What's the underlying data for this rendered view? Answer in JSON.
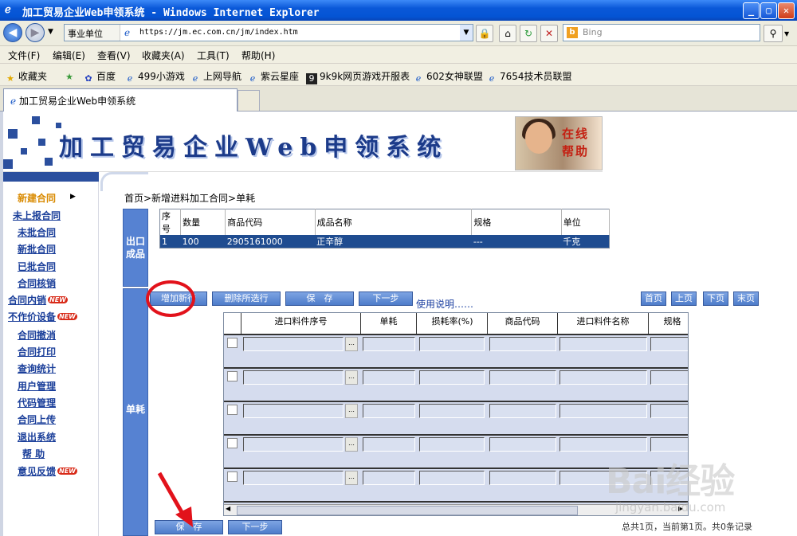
{
  "window": {
    "title": "加工贸易企业Web申领系统 - Windows Internet Explorer",
    "buttons": {
      "minimize": "_",
      "maximize": "▢",
      "close": "✕"
    }
  },
  "addressbar": {
    "segment": "事业单位",
    "url": "https://jm.ec.com.cn/jm/index.htm",
    "search_placeholder": "Bing"
  },
  "menu": [
    "文件(F)",
    "编辑(E)",
    "查看(V)",
    "收藏夹(A)",
    "工具(T)",
    "帮助(H)"
  ],
  "favorites": {
    "label": "收藏夹",
    "items": [
      "百度",
      "499小游戏",
      "上网导航",
      "紫云星座",
      "9k9k网页游戏开服表",
      "602女神联盟",
      "7654技术员联盟"
    ]
  },
  "tab": {
    "title": "加工贸易企业Web申领系统"
  },
  "banner": {
    "title": "加工贸易企业Web申领系统",
    "help_line1": "在线",
    "help_line2": "帮助"
  },
  "sidebar": {
    "items": [
      {
        "label": "新建合同",
        "active": true,
        "new": false
      },
      {
        "label": "未上报合同",
        "active": false,
        "new": false
      },
      {
        "label": "未批合同",
        "active": false,
        "new": false
      },
      {
        "label": "新批合同",
        "active": false,
        "new": false
      },
      {
        "label": "已批合同",
        "active": false,
        "new": false
      },
      {
        "label": "合同核销",
        "active": false,
        "new": false
      },
      {
        "label": "合同内销",
        "active": false,
        "new": true
      },
      {
        "label": "不作价设备",
        "active": false,
        "new": true
      },
      {
        "label": "合同撤消",
        "active": false,
        "new": false
      },
      {
        "label": "合同打印",
        "active": false,
        "new": false
      },
      {
        "label": "查询统计",
        "active": false,
        "new": false
      },
      {
        "label": "用户管理",
        "active": false,
        "new": false
      },
      {
        "label": "代码管理",
        "active": false,
        "new": false
      },
      {
        "label": "合同上传",
        "active": false,
        "new": false
      },
      {
        "label": "退出系统",
        "active": false,
        "new": false
      },
      {
        "label": "帮  助",
        "active": false,
        "new": false
      },
      {
        "label": "意见反馈",
        "active": false,
        "new": true
      }
    ],
    "new_badge": "NEW"
  },
  "main": {
    "breadcrumb": "首页>新增进料加工合同>单耗",
    "export_section": "出口成品",
    "consumption_section": "单耗",
    "product_table": {
      "headers": [
        "序号",
        "数量",
        "商品代码",
        "成品名称",
        "规格",
        "单位"
      ],
      "rows": [
        [
          "1",
          "100",
          "2905161000",
          "正辛醇",
          "---",
          "千克"
        ]
      ]
    },
    "buttons": {
      "add": "增加新行",
      "delete": "删除所选行",
      "save": "保　存",
      "next": "下一步",
      "usage": "使用说明……",
      "first": "首页",
      "prev": "上页",
      "nextpage": "下页",
      "last": "末页",
      "bottom_save": "保　存",
      "bottom_next": "下一步"
    },
    "grid_headers": [
      "进口料件序号",
      "单耗",
      "损耗率(%)",
      "商品代码",
      "进口料件名称",
      "规格"
    ],
    "grid_row_count": 5,
    "footer": "总共1页，当前第1页。共0条记录"
  },
  "watermark": {
    "brand": "Bai经验",
    "url": "jingyan.baidu.com"
  },
  "colors": {
    "accent": "#5682d2",
    "highlight": "#e2121b"
  }
}
